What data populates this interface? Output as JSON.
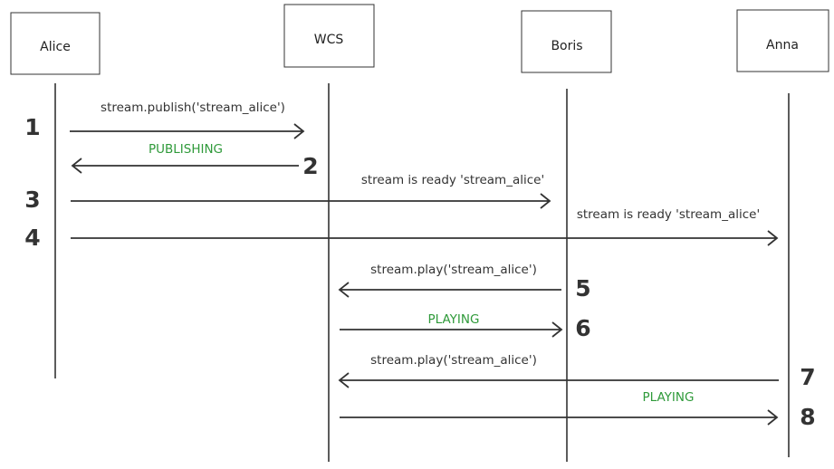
{
  "participants": [
    {
      "name": "Alice"
    },
    {
      "name": "WCS"
    },
    {
      "name": "Boris"
    },
    {
      "name": "Anna"
    }
  ],
  "messages": [
    {
      "step": "1",
      "label": "stream.publish('stream_alice')",
      "from": "Alice",
      "to": "WCS",
      "status": false
    },
    {
      "step": "2",
      "label": "PUBLISHING",
      "from": "WCS",
      "to": "Alice",
      "status": true
    },
    {
      "step": "3",
      "label": "stream is ready 'stream_alice'",
      "from": "Alice",
      "to": "Boris",
      "status": false
    },
    {
      "step": "4",
      "label": "stream is ready 'stream_alice'",
      "from": "Alice",
      "to": "Anna",
      "status": false
    },
    {
      "step": "5",
      "label": "stream.play('stream_alice')",
      "from": "Boris",
      "to": "WCS",
      "status": false
    },
    {
      "step": "6",
      "label": "PLAYING",
      "from": "WCS",
      "to": "Boris",
      "status": true
    },
    {
      "step": "7",
      "label": "stream.play('stream_alice')",
      "from": "Anna",
      "to": "WCS",
      "status": false
    },
    {
      "step": "8",
      "label": "PLAYING",
      "from": "WCS",
      "to": "Anna",
      "status": true
    }
  ],
  "colors": {
    "status_text": "#2f9a3a",
    "line": "#333333"
  }
}
